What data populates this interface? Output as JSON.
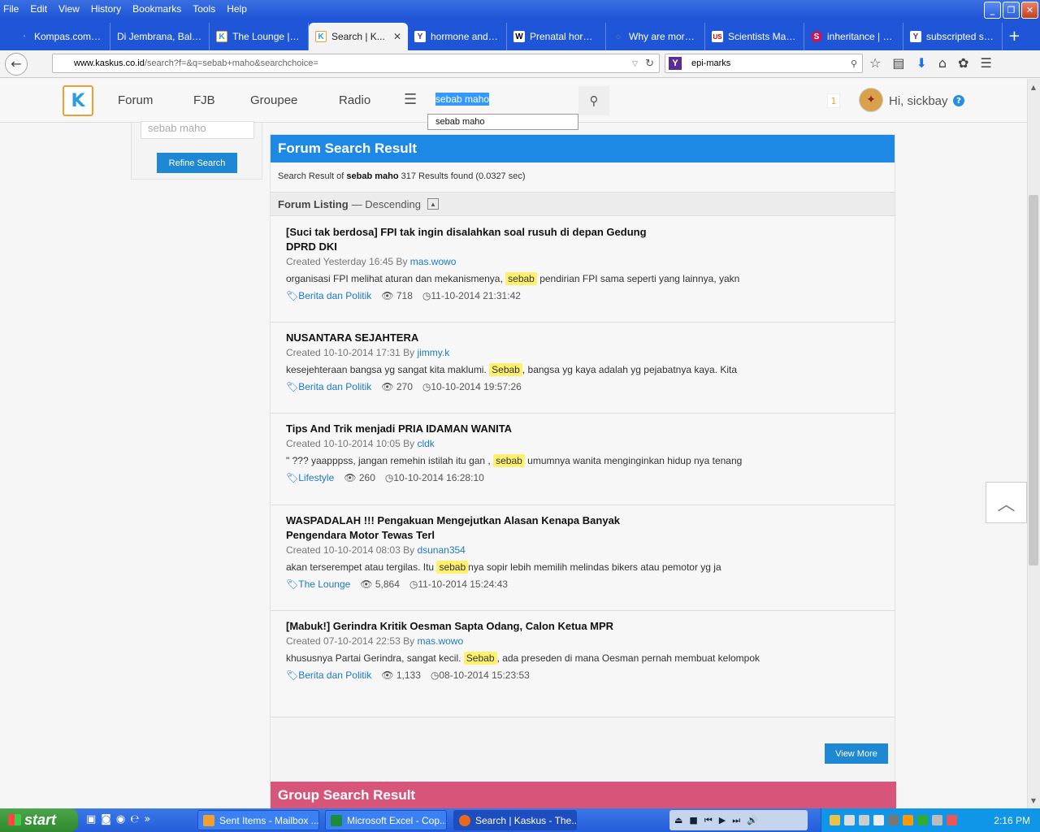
{
  "browser": {
    "menu": [
      "File",
      "Edit",
      "View",
      "History",
      "Bookmarks",
      "Tools",
      "Help"
    ],
    "tabs": [
      {
        "title": "Kompas.com - ...",
        "icon": "kompas-icon"
      },
      {
        "title": "Di Jembrana, Bali: L...",
        "icon": "blank-icon"
      },
      {
        "title": "The Lounge | K...",
        "icon": "kaskus-icon"
      },
      {
        "title": "Search | K...",
        "icon": "kaskus-icon",
        "active": true
      },
      {
        "title": "hormone and g...",
        "icon": "yahoo-icon"
      },
      {
        "title": "Prenatal horm...",
        "icon": "wikipedia-icon"
      },
      {
        "title": "Why are more ...",
        "icon": "spinner-icon"
      },
      {
        "title": "Scientists May ...",
        "icon": "usnews-icon"
      },
      {
        "title": "inheritance | e...",
        "icon": "s-icon"
      },
      {
        "title": "subscripted sy...",
        "icon": "yahoo-icon"
      }
    ],
    "url_host": "www.kaskus.co.id",
    "url_path": "/search?f=&q=sebab+maho&searchchoice=",
    "search_value": "epi-marks"
  },
  "site": {
    "nav": [
      "Forum",
      "FJB",
      "Groupee",
      "Radio"
    ],
    "search_value": "sebab maho",
    "autocomplete": "sebab maho",
    "notif_count": "1",
    "greeting": "Hi, sickbay"
  },
  "sidebar": {
    "search_placeholder": "sebab maho",
    "refine_label": "Refine Search"
  },
  "results": {
    "header": "Forum Search Result",
    "summary_prefix": "Search Result of",
    "query": "sebab maho",
    "summary_suffix": "317 Results found (0.0327 sec)",
    "listing_label": "Forum Listing",
    "listing_sort": "— Descending",
    "items": [
      {
        "title": "[Suci tak berdosa] FPI tak ingin disalahkan soal rusuh di depan Gedung DPRD DKI",
        "created": "Created Yesterday 16:45 By",
        "author": "mas.wowo",
        "snippet_before": "organisasi FPI melihat aturan dan mekanismenya,",
        "snippet_hl": "sebab",
        "snippet_after": "pendirian FPI sama seperti yang lainnya, yakn",
        "category": "Berita dan Politik",
        "views": "718",
        "time": "11-10-2014 21:31:42"
      },
      {
        "title": "NUSANTARA SEJAHTERA",
        "created": "Created 10-10-2014 17:31 By",
        "author": "jimmy.k",
        "snippet_before": "kesejehteraan bangsa yg sangat kita maklumi.",
        "snippet_hl": "Sebab",
        "snippet_after": ", bangsa yg kaya adalah yg pejabatnya kaya. Kita",
        "category": "Berita dan Politik",
        "views": "270",
        "time": "10-10-2014 19:57:26"
      },
      {
        "title": "Tips And Trik menjadi PRIA IDAMAN WANITA",
        "created": "Created 10-10-2014 10:05 By",
        "author": "cldk",
        "snippet_before": "\" ??? yaapppss, jangan remehin istilah itu gan ,",
        "snippet_hl": "sebab",
        "snippet_after": "umumnya wanita menginginkan hidup nya tenang",
        "category": "Lifestyle",
        "views": "260",
        "time": "10-10-2014 16:28:10"
      },
      {
        "title": "WASPADALAH !!! Pengakuan Mengejutkan Alasan Kenapa Banyak Pengendara Motor Tewas Terl",
        "created": "Created 10-10-2014 08:03 By",
        "author": "dsunan354",
        "snippet_before": "akan terserempet atau tergilas. Itu",
        "snippet_hl": "sebab",
        "snippet_after": "nya sopir lebih memilih melindas bikers atau pemotor yg ja",
        "category": "The Lounge",
        "views": "5,864",
        "time": "11-10-2014 15:24:43"
      },
      {
        "title": "[Mabuk!] Gerindra Kritik Oesman Sapta Odang, Calon Ketua MPR",
        "created": "Created 07-10-2014 22:53 By",
        "author": "mas.wowo",
        "snippet_before": "khususnya Partai Gerindra, sangat kecil.",
        "snippet_hl": "Sebab",
        "snippet_after": ", ada preseden di mana Oesman pernah membuat kelompok",
        "category": "Berita dan Politik",
        "views": "1,133",
        "time": "08-10-2014 15:23:53"
      }
    ],
    "view_more": "View More",
    "group_header": "Group Search Result"
  },
  "taskbar": {
    "start": "start",
    "items": [
      {
        "label": "Sent Items - Mailbox ...",
        "icon": "outlook-icon"
      },
      {
        "label": "Microsoft Excel - Cop...",
        "icon": "excel-icon"
      },
      {
        "label": "Search | Kaskus - The...",
        "icon": "firefox-icon"
      }
    ],
    "clock": "2:16 PM"
  }
}
